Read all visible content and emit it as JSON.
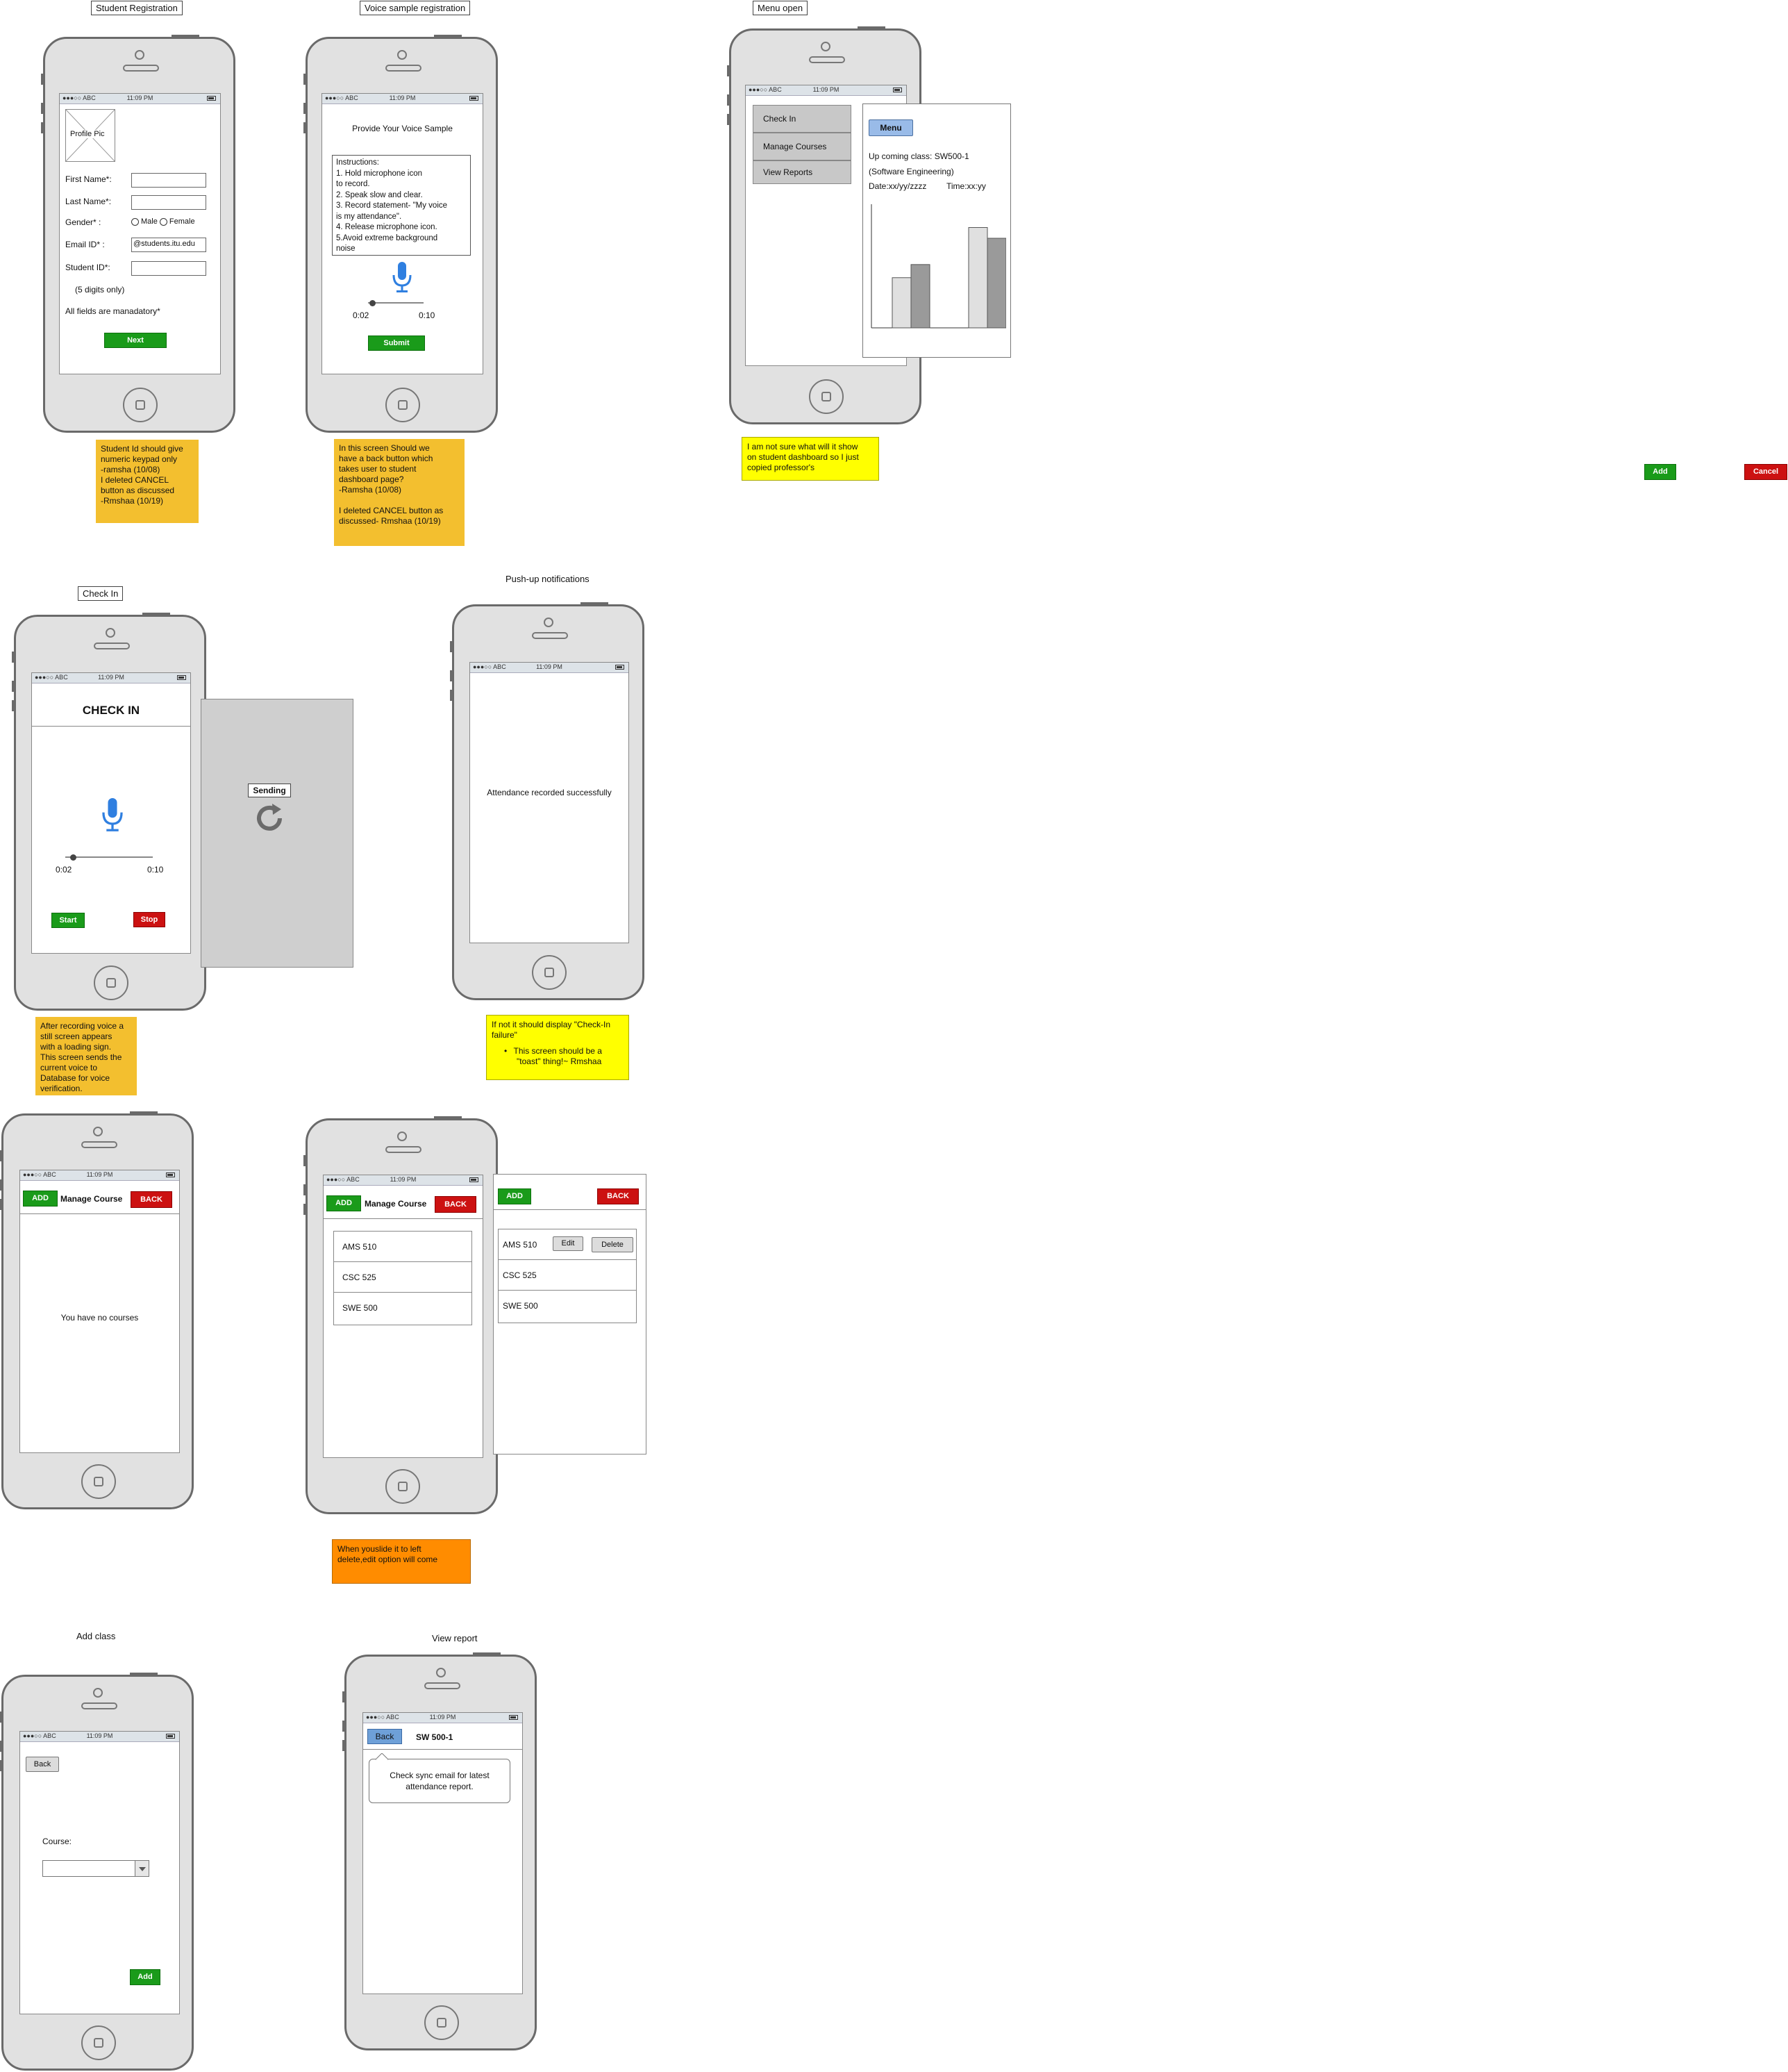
{
  "screens": {
    "registration": {
      "label": "Student Registration",
      "status_time": "11:09 PM",
      "carrier": "●●●○○ ABC",
      "profile_pic": "Profile Pic",
      "first_name": "First Name*:",
      "last_name": "Last Name*:",
      "gender": "Gender* :",
      "male": "Male",
      "female": "Female",
      "email": "Email ID* :",
      "email_value": "@students.itu.edu",
      "student_id": "Student ID*:",
      "digits": "(5 digits only)",
      "mandatory": "All fields are manadatory*",
      "next": "Next"
    },
    "voice": {
      "label": "Voice sample registration",
      "title": "Provide Your Voice Sample",
      "instructions": [
        "Instructions:",
        "1. Hold  microphone icon",
        "to record.",
        "2. Speak slow and clear.",
        "3. Record statement- \"My voice",
        "is my attendance\".",
        "4. Release microphone icon.",
        "5.Avoid extreme background",
        "noise"
      ],
      "t_start": "0:02",
      "t_end": "0:10",
      "submit": "Submit"
    },
    "menu": {
      "label": "Menu open",
      "items": [
        "Check In",
        "Manage Courses",
        "View Reports"
      ],
      "menu_button": "Menu",
      "upcoming": "Up coming class: SW500-1",
      "course": "(Software Engineering)",
      "date": "Date:xx/yy/zzzz",
      "time": "Time:xx:yy"
    },
    "checkin": {
      "label": "Check In",
      "title": "CHECK IN",
      "t_start": "0:02",
      "t_end": "0:10",
      "start": "Start",
      "stop": "Stop",
      "sending": "Sending"
    },
    "push": {
      "label": "Push-up notifications",
      "message": "Attendance recorded successfully"
    },
    "manage_empty": {
      "add": "ADD",
      "title": "Manage Course",
      "back": "BACK",
      "empty": "You have no courses"
    },
    "manage_list": {
      "add": "ADD",
      "title": "Manage Course",
      "back": "BACK",
      "courses": [
        "AMS 510",
        "CSC 525",
        "SWE 500"
      ],
      "edit": "Edit",
      "delete": "Delete"
    },
    "add_class": {
      "label": "Add class",
      "back": "Back",
      "course": "Course:",
      "add": "Add"
    },
    "view_report": {
      "label": "View report",
      "back": "Back",
      "title": "SW 500-1",
      "message_1": "Check sync email for latest",
      "message_2": "attendance report."
    }
  },
  "notes": {
    "registration": [
      "Student Id should give",
      "numeric keypad only",
      "-ramsha (10/08)",
      "I deleted CANCEL",
      "button as discussed",
      "-Rmshaa (10/19)"
    ],
    "voice": [
      "In this screen Should we",
      "have a back button which",
      "takes user to student",
      "dashboard page?",
      "-Ramsha (10/08)",
      "",
      "I deleted CANCEL button as",
      "discussed- Rmshaa (10/19)"
    ],
    "menu": [
      "I am not sure what will it show",
      "on student dashboard so I just",
      "copied professor's"
    ],
    "checkin": [
      "After recording voice a",
      "still screen appears",
      "with a loading sign.",
      "This screen sends the",
      "current voice to",
      "Database for voice",
      "verification."
    ],
    "push": [
      "If not it should display \"Check-In",
      "failure\""
    ],
    "push_bullet": [
      "This screen should be a",
      "\"toast\" thing!~ Rmshaa"
    ],
    "manage": [
      "When youslide it to left",
      "delete,edit option will come"
    ]
  },
  "loose_buttons": {
    "add": "Add",
    "cancel": "Cancel"
  },
  "chart_data": {
    "type": "bar",
    "categories": [
      "",
      ""
    ],
    "series": [
      {
        "values": [
          42,
          84
        ]
      },
      {
        "values": [
          53,
          75
        ]
      }
    ],
    "ylim": [
      0,
      100
    ]
  },
  "colors": {
    "green": "#1a9b1a",
    "red": "#cc1111",
    "note_orange": "#f3bf2f",
    "note_yellow": "#ffff00",
    "note_dark_orange": "#ff8c00",
    "menu_blue": "#99bbe8",
    "mic_blue": "#2f7fe0"
  }
}
